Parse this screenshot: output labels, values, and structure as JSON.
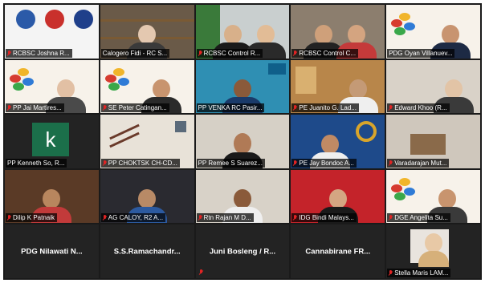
{
  "participants": [
    {
      "name": "RCBSC Joshna Rotary...",
      "display": "RCBSC Joshna R..."
    },
    {
      "name": "Calogero Fidi - RC S...",
      "display": "Calogero Fidi - RC S..."
    },
    {
      "name": "RCBSC Control R...",
      "display": "RCBSC Control R..."
    },
    {
      "name": "RCBSC Control C...",
      "display": "RCBSC Control C..."
    },
    {
      "name": "PDG Oyan Villanueva...",
      "display": "PDG Oyan Villanuev..."
    },
    {
      "name": "PP Jai Martires...",
      "display": "PP Jai Martires..."
    },
    {
      "name": "SE Peter Catingan...",
      "display": "SE Peter Catingan..."
    },
    {
      "name": "PP VENKA RC Pasir...",
      "display": "PP VENKA RC Pasir..."
    },
    {
      "name": "PE Juanito G. Lad...",
      "display": "PE Juanito G. Lad..."
    },
    {
      "name": "Edward Khoo (R...",
      "display": "Edward Khoo (R..."
    },
    {
      "name": "PP Kenneth So, R...",
      "display": "PP Kenneth So, R..."
    },
    {
      "name": "PP CHOKTSK CH-CD...",
      "display": "PP CHOKTSK CH-CD..."
    },
    {
      "name": "PP Remee S Suarez...",
      "display": "PP Remee S Suarez..."
    },
    {
      "name": "PE Jay Bondoc A...",
      "display": "PE Jay Bondoc A..."
    },
    {
      "name": "Varadarajan Mut...",
      "display": "Varadarajan Mut..."
    },
    {
      "name": "Dilip K Patnaik",
      "display": "Dilip K Patnaik"
    },
    {
      "name": "AG CALOY, R2 A...",
      "display": "AG CALOY, R2 A..."
    },
    {
      "name": "Rtn Rajan M D...",
      "display": "Rtn Rajan M D..."
    },
    {
      "name": "IDG Bindi Malays...",
      "display": "IDG Bindi Malays..."
    },
    {
      "name": "DGE Angelita Su...",
      "display": "DGE Angelita Su..."
    },
    {
      "name": "PDG Nilawati N...",
      "display": "PDG Nilawati N..."
    },
    {
      "name": "S.S.Ramachandr...",
      "display": "S.S.Ramachandr..."
    },
    {
      "name": "Juni Bosleng / R...",
      "display": "Juni Bosleng / R..."
    },
    {
      "name": "Cannabirane FR...",
      "display": "Cannabirane FR..."
    },
    {
      "name": "Stella Maris LAM...",
      "display": "Stella Maris LAM..."
    }
  ],
  "kenneth_avatar_letter": "k",
  "colors": {
    "active_border": "#e6d21a",
    "mic_muted": "#e02424",
    "grid_bg": "#1a1a1a"
  }
}
